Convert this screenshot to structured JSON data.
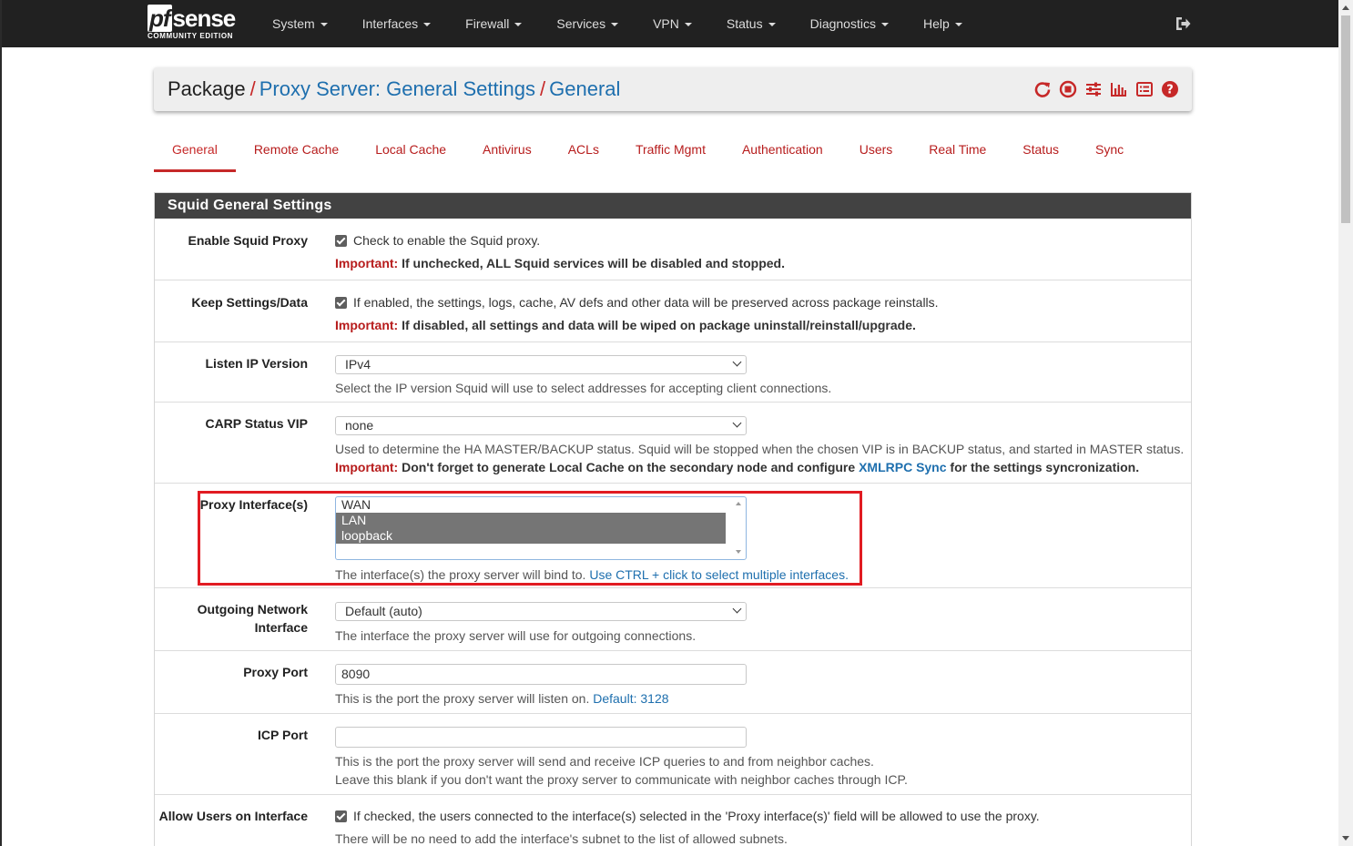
{
  "brand": {
    "logo_pf": "pf",
    "logo_sense": "sense",
    "edition": "COMMUNITY EDITION"
  },
  "nav": {
    "items": [
      {
        "label": "System"
      },
      {
        "label": "Interfaces"
      },
      {
        "label": "Firewall"
      },
      {
        "label": "Services"
      },
      {
        "label": "VPN"
      },
      {
        "label": "Status"
      },
      {
        "label": "Diagnostics"
      },
      {
        "label": "Help"
      }
    ],
    "logout_icon": "sign-out-icon"
  },
  "breadcrumb": {
    "root": "Package",
    "sep": "/",
    "level1": "Proxy Server: General Settings",
    "level2": "General"
  },
  "header_icons": [
    "restart-icon",
    "stop-icon",
    "settings-sliders-icon",
    "chart-icon",
    "log-list-icon",
    "help-icon"
  ],
  "tabs": [
    {
      "label": "General",
      "active": true
    },
    {
      "label": "Remote Cache"
    },
    {
      "label": "Local Cache"
    },
    {
      "label": "Antivirus"
    },
    {
      "label": "ACLs"
    },
    {
      "label": "Traffic Mgmt"
    },
    {
      "label": "Authentication"
    },
    {
      "label": "Users"
    },
    {
      "label": "Real Time"
    },
    {
      "label": "Status"
    },
    {
      "label": "Sync"
    }
  ],
  "panel": {
    "title": "Squid General Settings",
    "enable_squid": {
      "label": "Enable Squid Proxy",
      "checked": true,
      "text": "Check to enable the Squid proxy.",
      "important_label": "Important:",
      "important_text": "If unchecked, ALL Squid services will be disabled and stopped."
    },
    "keep_settings": {
      "label": "Keep Settings/Data",
      "checked": true,
      "text": "If enabled, the settings, logs, cache, AV defs and other data will be preserved across package reinstalls.",
      "important_label": "Important:",
      "important_text": "If disabled, all settings and data will be wiped on package uninstall/reinstall/upgrade."
    },
    "listen_ip": {
      "label": "Listen IP Version",
      "value": "IPv4",
      "help": "Select the IP version Squid will use to select addresses for accepting client connections."
    },
    "carp_vip": {
      "label": "CARP Status VIP",
      "value": "none",
      "help": "Used to determine the HA MASTER/BACKUP status. Squid will be stopped when the chosen VIP is in BACKUP status, and started in MASTER status.",
      "important_label": "Important:",
      "important_pre": "Don't forget to generate Local Cache on the secondary node and configure",
      "important_link": "XMLRPC Sync",
      "important_post": "for the settings syncronization."
    },
    "proxy_interfaces": {
      "label": "Proxy Interface(s)",
      "options": [
        {
          "label": "WAN",
          "selected": false
        },
        {
          "label": "LAN",
          "selected": true
        },
        {
          "label": "loopback",
          "selected": true
        }
      ],
      "help": "The interface(s) the proxy server will bind to.",
      "help_link": "Use CTRL + click to select multiple interfaces."
    },
    "outgoing": {
      "label_line1": "Outgoing Network",
      "label_line2": "Interface",
      "value": "Default (auto)",
      "help": "The interface the proxy server will use for outgoing connections."
    },
    "proxy_port": {
      "label": "Proxy Port",
      "value": "8090",
      "help": "This is the port the proxy server will listen on.",
      "help_link": "Default: 3128"
    },
    "icp_port": {
      "label": "ICP Port",
      "value": "",
      "help1": "This is the port the proxy server will send and receive ICP queries to and from neighbor caches.",
      "help2": "Leave this blank if you don't want the proxy server to communicate with neighbor caches through ICP."
    },
    "allow_users": {
      "label": "Allow Users on Interface",
      "checked": true,
      "text": "If checked, the users connected to the interface(s) selected in the 'Proxy interface(s)' field will be allowed to use the proxy.",
      "help": "There will be no need to add the interface's subnet to the list of allowed subnets."
    }
  },
  "colors": {
    "navbar": "#212121",
    "accent_red": "#c62828",
    "link_blue": "#1e6fae",
    "panel_heading": "#424242",
    "highlight_box": "#e11b22"
  }
}
